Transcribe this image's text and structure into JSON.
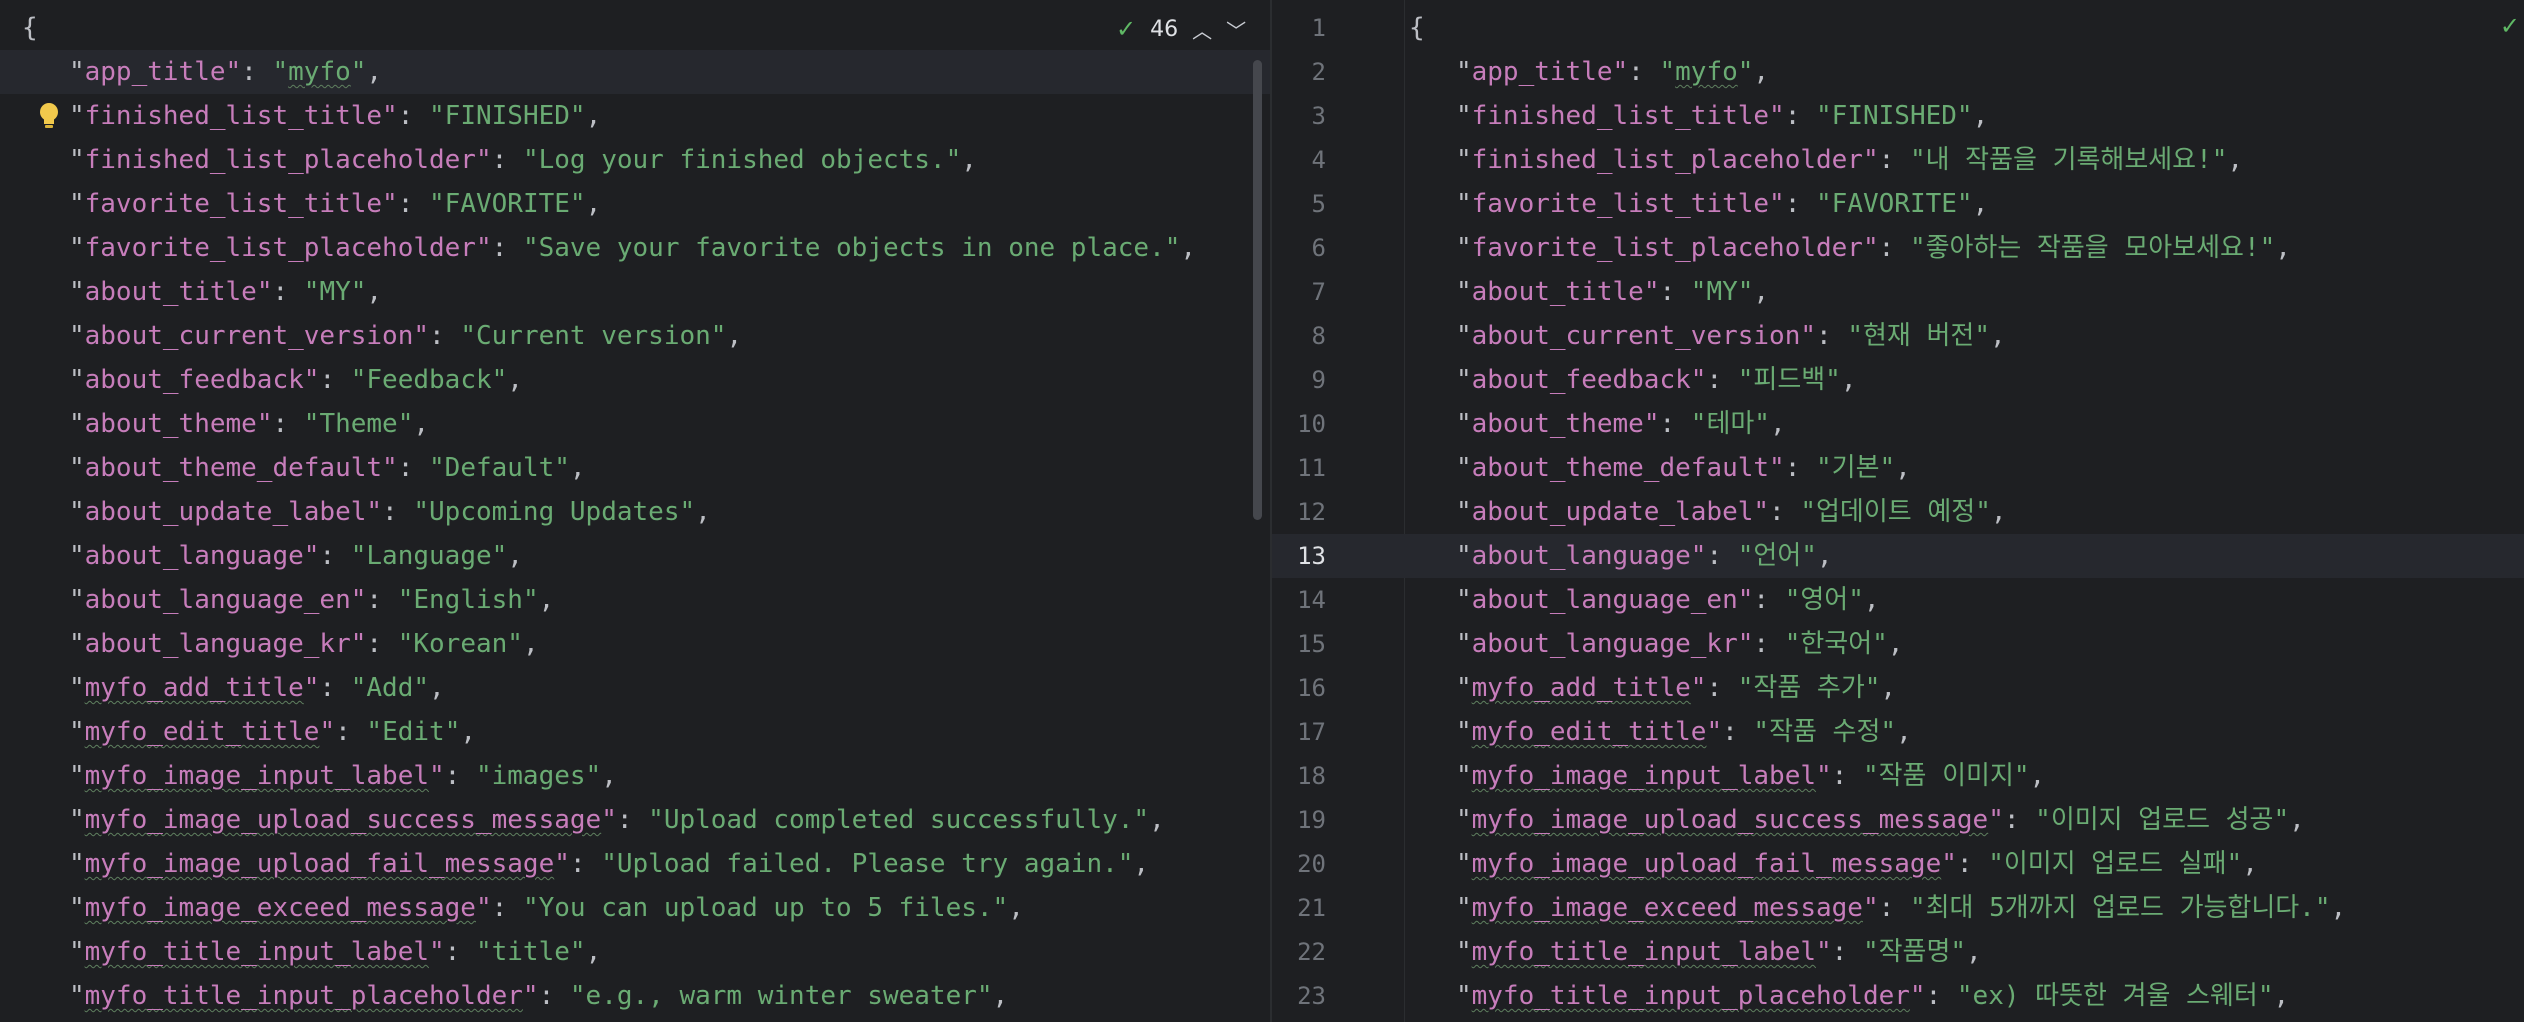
{
  "left_pane": {
    "inspection_count": "46",
    "lines": [
      {
        "key": null,
        "value": null,
        "raw": "{"
      },
      {
        "key": "app_title",
        "value": "myfo",
        "squig_val": true
      },
      {
        "key": "finished_list_title",
        "value": "FINISHED"
      },
      {
        "key": "finished_list_placeholder",
        "value": "Log your finished objects."
      },
      {
        "key": "favorite_list_title",
        "value": "FAVORITE"
      },
      {
        "key": "favorite_list_placeholder",
        "value": "Save your favorite objects in one place."
      },
      {
        "key": "about_title",
        "value": "MY"
      },
      {
        "key": "about_current_version",
        "value": "Current version"
      },
      {
        "key": "about_feedback",
        "value": "Feedback"
      },
      {
        "key": "about_theme",
        "value": "Theme"
      },
      {
        "key": "about_theme_default",
        "value": "Default"
      },
      {
        "key": "about_update_label",
        "value": "Upcoming Updates"
      },
      {
        "key": "about_language",
        "value": "Language"
      },
      {
        "key": "about_language_en",
        "value": "English"
      },
      {
        "key": "about_language_kr",
        "value": "Korean"
      },
      {
        "key": "myfo_add_title",
        "value": "Add",
        "squig_key": true
      },
      {
        "key": "myfo_edit_title",
        "value": "Edit",
        "squig_key": true
      },
      {
        "key": "myfo_image_input_label",
        "value": "images",
        "squig_key": true
      },
      {
        "key": "myfo_image_upload_success_message",
        "value": "Upload completed successfully.",
        "squig_key": true
      },
      {
        "key": "myfo_image_upload_fail_message",
        "value": "Upload failed. Please try again.",
        "squig_key": true
      },
      {
        "key": "myfo_image_exceed_message",
        "value": "You can upload up to 5 files.",
        "squig_key": true
      },
      {
        "key": "myfo_title_input_label",
        "value": "title",
        "squig_key": true
      },
      {
        "key": "myfo_title_input_placeholder",
        "value": "e.g., warm winter sweater",
        "squig_key": true
      }
    ]
  },
  "right_pane": {
    "current_line": "13",
    "line_numbers": [
      "1",
      "2",
      "3",
      "4",
      "5",
      "6",
      "7",
      "8",
      "9",
      "10",
      "11",
      "12",
      "13",
      "14",
      "15",
      "16",
      "17",
      "18",
      "19",
      "20",
      "21",
      "22",
      "23"
    ],
    "lines": [
      {
        "key": null,
        "value": null,
        "raw": "{"
      },
      {
        "key": "app_title",
        "value": "myfo",
        "squig_val": true
      },
      {
        "key": "finished_list_title",
        "value": "FINISHED"
      },
      {
        "key": "finished_list_placeholder",
        "value": "내 작품을 기록해보세요!"
      },
      {
        "key": "favorite_list_title",
        "value": "FAVORITE"
      },
      {
        "key": "favorite_list_placeholder",
        "value": "좋아하는 작품을 모아보세요!"
      },
      {
        "key": "about_title",
        "value": "MY"
      },
      {
        "key": "about_current_version",
        "value": "현재 버전"
      },
      {
        "key": "about_feedback",
        "value": "피드백"
      },
      {
        "key": "about_theme",
        "value": "테마"
      },
      {
        "key": "about_theme_default",
        "value": "기본"
      },
      {
        "key": "about_update_label",
        "value": "업데이트 예정"
      },
      {
        "key": "about_language",
        "value": "언어"
      },
      {
        "key": "about_language_en",
        "value": "영어"
      },
      {
        "key": "about_language_kr",
        "value": "한국어"
      },
      {
        "key": "myfo_add_title",
        "value": "작품 추가",
        "squig_key": true
      },
      {
        "key": "myfo_edit_title",
        "value": "작품 수정",
        "squig_key": true
      },
      {
        "key": "myfo_image_input_label",
        "value": "작품 이미지",
        "squig_key": true
      },
      {
        "key": "myfo_image_upload_success_message",
        "value": "이미지 업로드 성공",
        "squig_key": true
      },
      {
        "key": "myfo_image_upload_fail_message",
        "value": "이미지 업로드 실패",
        "squig_key": true
      },
      {
        "key": "myfo_image_exceed_message",
        "value": "최대 5개까지 업로드 가능합니다.",
        "squig_key": true
      },
      {
        "key": "myfo_title_input_label",
        "value": "작품명",
        "squig_key": true
      },
      {
        "key": "myfo_title_input_placeholder",
        "value": "ex) 따뜻한 겨울 스웨터",
        "squig_key": true
      }
    ]
  },
  "icons": {
    "inspection": "check-icon",
    "prev": "chevron-up-icon",
    "next": "chevron-down-icon",
    "intention": "lightbulb-icon"
  },
  "colors": {
    "background": "#1e1f22",
    "key": "#c77dbb",
    "string": "#6aab73",
    "punctuation": "#bcbec4",
    "accent": "#3574f0",
    "check": "#5fb865",
    "bulb": "#f2c94c"
  }
}
